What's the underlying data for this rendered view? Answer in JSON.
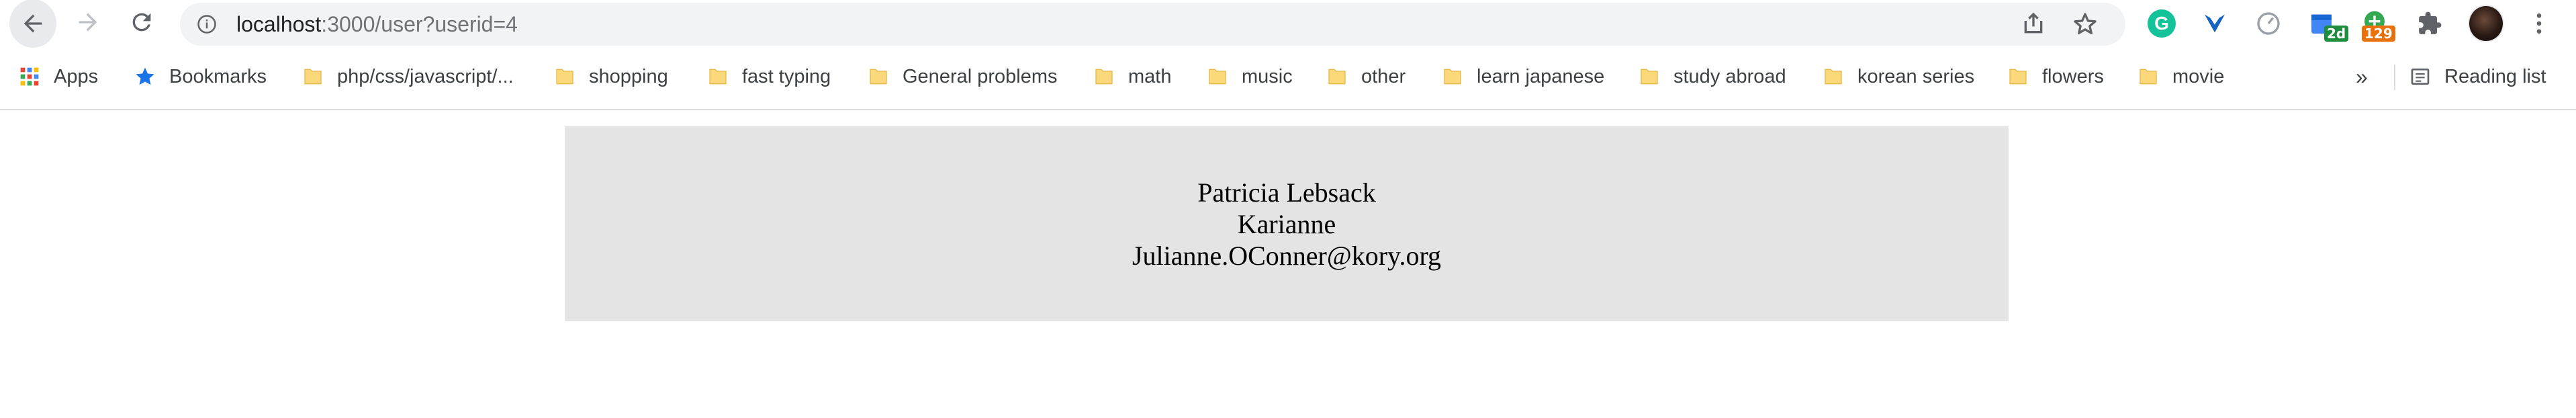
{
  "browser": {
    "url_host": "localhost",
    "url_path": ":3000/user?userid=4",
    "icons": {
      "back": "back-arrow-icon",
      "forward": "forward-arrow-icon",
      "reload": "reload-icon",
      "info": "info-icon",
      "share": "share-icon",
      "star": "star-icon",
      "menu": "more-vert-icon"
    },
    "extensions": {
      "grammarly_letter": "G",
      "calendar_badge": "2d",
      "counter_badge": "129"
    },
    "accent": "#1a73e8"
  },
  "bookmarks": {
    "items": [
      {
        "label": "Apps",
        "icon": "apps-grid-icon"
      },
      {
        "label": "Bookmarks",
        "icon": "star-icon"
      },
      {
        "label": "php/css/javascript/...",
        "icon": "folder-icon"
      },
      {
        "label": "shopping",
        "icon": "folder-icon"
      },
      {
        "label": "fast typing",
        "icon": "folder-icon"
      },
      {
        "label": "General problems",
        "icon": "folder-icon"
      },
      {
        "label": "math",
        "icon": "folder-icon"
      },
      {
        "label": "music",
        "icon": "folder-icon"
      },
      {
        "label": "other",
        "icon": "folder-icon"
      },
      {
        "label": "learn japanese",
        "icon": "folder-icon"
      },
      {
        "label": "study abroad",
        "icon": "folder-icon"
      },
      {
        "label": "korean series",
        "icon": "folder-icon"
      },
      {
        "label": "flowers",
        "icon": "folder-icon"
      },
      {
        "label": "movie",
        "icon": "folder-icon"
      }
    ],
    "overflow": "»",
    "reading_list": "Reading list"
  },
  "user": {
    "name": "Patricia Lebsack",
    "username": "Karianne",
    "email": "Julianne.OConner@kory.org"
  }
}
